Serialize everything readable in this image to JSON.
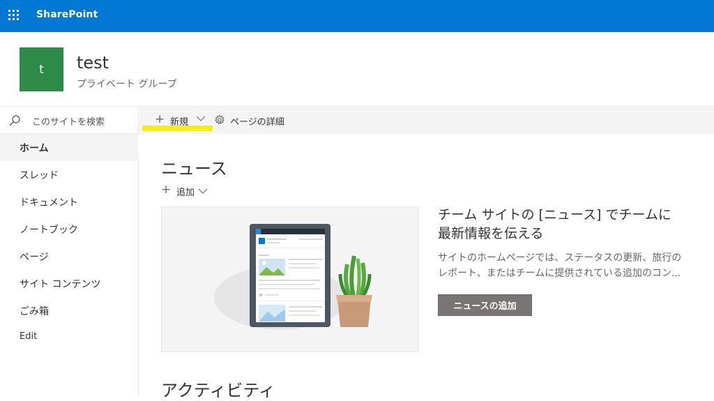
{
  "suite": {
    "app_name": "SharePoint",
    "bar_color": "#0078d4"
  },
  "site": {
    "logo_letter": "t",
    "logo_color": "#2e8a47",
    "title": "test",
    "subtitle": "プライベート グループ"
  },
  "search": {
    "placeholder": "このサイトを検索",
    "icon": "search-icon"
  },
  "nav": {
    "items": [
      {
        "label": "ホーム",
        "active": true
      },
      {
        "label": "スレッド",
        "active": false
      },
      {
        "label": "ドキュメント",
        "active": false
      },
      {
        "label": "ノートブック",
        "active": false
      },
      {
        "label": "ページ",
        "active": false
      },
      {
        "label": "サイト コンテンツ",
        "active": false
      },
      {
        "label": "ごみ箱",
        "active": false
      },
      {
        "label": "Edit",
        "active": false
      }
    ]
  },
  "commandbar": {
    "new_label": "新規",
    "details_label": "ページの詳細",
    "highlight_color": "#f7ef1b"
  },
  "news": {
    "title": "ニュース",
    "add_label": "追加",
    "promo_heading_line1": "チーム サイトの [ニュース] でチームに",
    "promo_heading_line2": "最新情報を伝える",
    "promo_body_line1": "サイトのホームページでは、ステータスの更新、旅行の",
    "promo_body_line2": "レポート、またはチームに提供されている追加のコン...",
    "button_label": "ニュースの追加"
  },
  "activity": {
    "title": "アクティビティ"
  }
}
